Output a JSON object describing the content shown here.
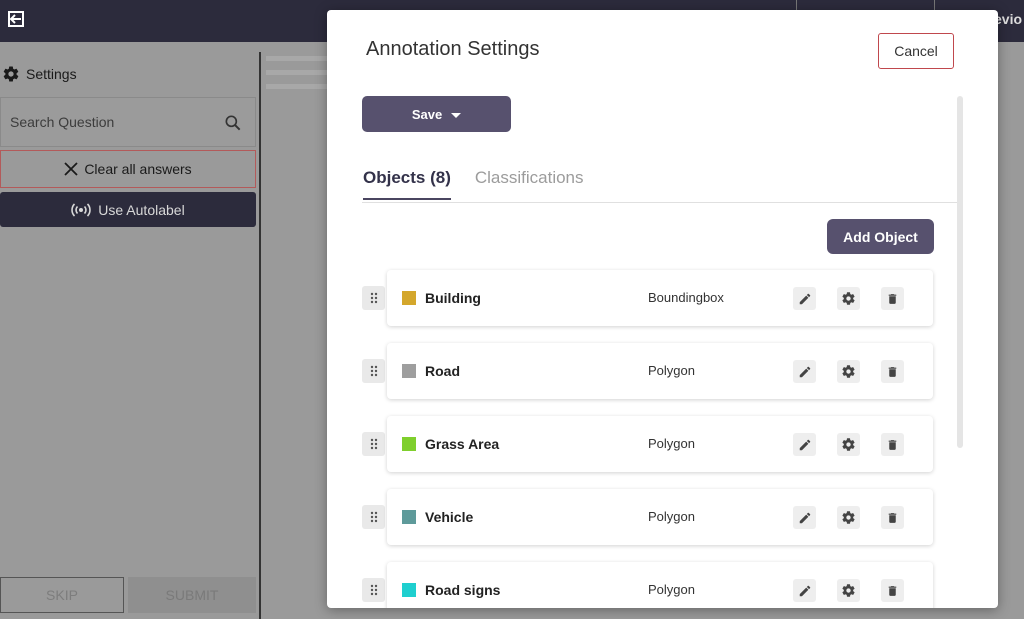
{
  "topbar": {
    "partial_label": "evio"
  },
  "sidebar": {
    "settings_label": "Settings",
    "search_placeholder": "Search Question",
    "clear_label": "Clear all answers",
    "autolabel_label": "Use Autolabel",
    "skip_label": "SKIP",
    "submit_label": "SUBMIT"
  },
  "modal": {
    "title": "Annotation Settings",
    "cancel_label": "Cancel",
    "save_label": "Save",
    "tabs": [
      {
        "label": "Objects (8)",
        "active": true
      },
      {
        "label": "Classifications",
        "active": false
      }
    ],
    "add_object_label": "Add Object",
    "objects": [
      {
        "name": "Building",
        "type": "Boundingbox",
        "color": "#d4a72c"
      },
      {
        "name": "Road",
        "type": "Polygon",
        "color": "#9e9e9e"
      },
      {
        "name": "Grass Area",
        "type": "Polygon",
        "color": "#7fcf2d"
      },
      {
        "name": "Vehicle",
        "type": "Polygon",
        "color": "#5e9a9a"
      },
      {
        "name": "Road signs",
        "type": "Polygon",
        "color": "#1fcfcf"
      }
    ]
  },
  "icons": {
    "exit": "exit-icon",
    "settings": "gear-icon",
    "search": "search-icon",
    "clear": "close-icon",
    "autolabel": "broadcast-icon",
    "save_dropdown": "chevron-down-icon",
    "drag": "drag-handle-icon",
    "edit": "pencil-icon",
    "object_settings": "gear-icon",
    "delete": "trash-icon"
  }
}
